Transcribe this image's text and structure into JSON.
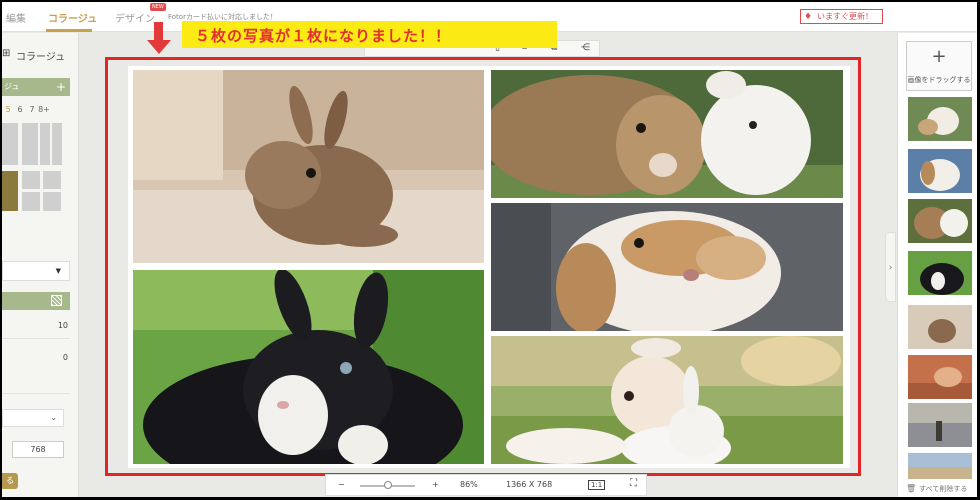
{
  "topbar": {
    "tab_edit": "編集",
    "tab_collage": "コラージュ",
    "tab_design": "デザイン",
    "new_badge": "NEW",
    "notice": "Fotorカード払いに対応しました！",
    "update_button": "いますぐ更新！"
  },
  "left_panel": {
    "collage_title": "コラージュ",
    "green_button": "ジュ",
    "photo_counts": [
      "5",
      "6",
      "7",
      "8+"
    ],
    "selected_count": "5",
    "value_1": "10",
    "value_2": "0",
    "height_value": "768",
    "apply_button": "る"
  },
  "banner": {
    "text": "５枚の写真が１枚になりました！！"
  },
  "zoombar": {
    "minus": "−",
    "plus": "+",
    "zoom": "86%",
    "size": "1366  X  768",
    "one_to_one": "1:1"
  },
  "right_panel": {
    "add_label": "画像をドラッグする",
    "delete_all": "すべて削除する"
  },
  "collage": {
    "photos": [
      "brown-bunny-on-carpet",
      "two-bunnies-brown-white",
      "lop-eared-bunny",
      "black-white-bunny-grass",
      "dog-with-bunny-toy"
    ]
  },
  "colors": {
    "accent_gold": "#c8a24a",
    "annotation_red": "#e02626",
    "banner_yellow": "#fbea14",
    "panel_green": "#a7b98c"
  }
}
